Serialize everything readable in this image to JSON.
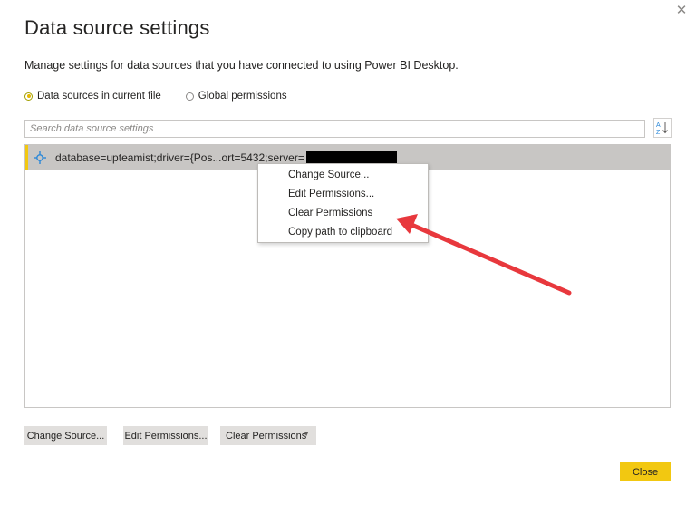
{
  "dialog": {
    "title": "Data source settings",
    "subtitle": "Manage settings for data sources that you have connected to using Power BI Desktop.",
    "close_icon": "close-icon"
  },
  "scope": {
    "options": [
      {
        "label": "Data sources in current file",
        "selected": true
      },
      {
        "label": "Global permissions",
        "selected": false
      }
    ]
  },
  "search": {
    "placeholder": "Search data source settings",
    "value": "",
    "sort_icon": "sort-az-icon"
  },
  "sources": [
    {
      "icon": "database-connector-icon",
      "text": "database=upteamist;driver={Pos...ort=5432;server=",
      "redacted": true
    }
  ],
  "context_menu": {
    "items": [
      "Change Source...",
      "Edit Permissions...",
      "Clear Permissions",
      "Copy path to clipboard"
    ]
  },
  "annotation": {
    "arrow_color": "#e8383d",
    "points_to": "Clear Permissions"
  },
  "buttons": {
    "change_source": "Change Source...",
    "edit_permissions": "Edit Permissions...",
    "clear_permissions": "Clear Permissions",
    "close": "Close"
  },
  "colors": {
    "accent": "#f2c811",
    "selected_row": "#c8c6c4",
    "secondary_button": "#e1dfdd",
    "icon_blue": "#2b88d8"
  }
}
